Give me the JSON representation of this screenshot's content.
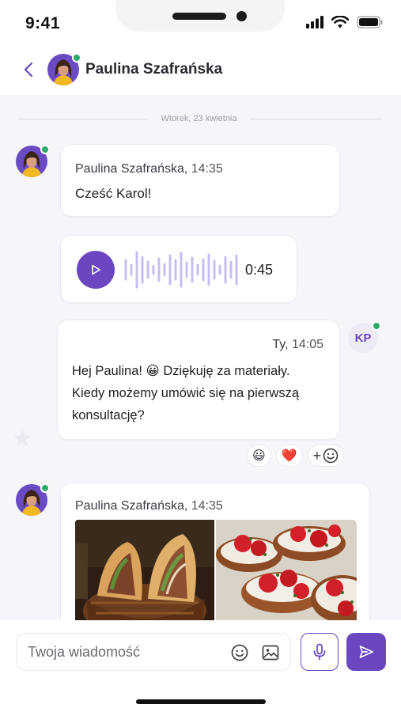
{
  "status_bar": {
    "time": "9:41"
  },
  "header": {
    "contact_name": "Paulina Szafrańska"
  },
  "date_separator": "Wtorek, 23 kwietnia",
  "messages": {
    "first": {
      "author": "Paulina Szafrańska",
      "time": "14:35",
      "text": "Cześć Karol!"
    },
    "voice": {
      "duration": "0:45"
    },
    "mine": {
      "author": "Ty",
      "time": "14:05",
      "text": "Hej Paulina! 😀 Dziękuję za materiały. Kiedy możemy umówić się na pierwszą konsultację?",
      "avatar_initials": "KP",
      "reactions": [
        "😃",
        "❤️"
      ],
      "add_reaction": "+"
    },
    "images": {
      "author": "Paulina Szafrańska",
      "time": "14:35"
    }
  },
  "composer": {
    "placeholder": "Twoja wiadomość"
  },
  "colors": {
    "accent": "#6b46c1",
    "online": "#2eaa6b",
    "background": "#f6f5fa"
  }
}
